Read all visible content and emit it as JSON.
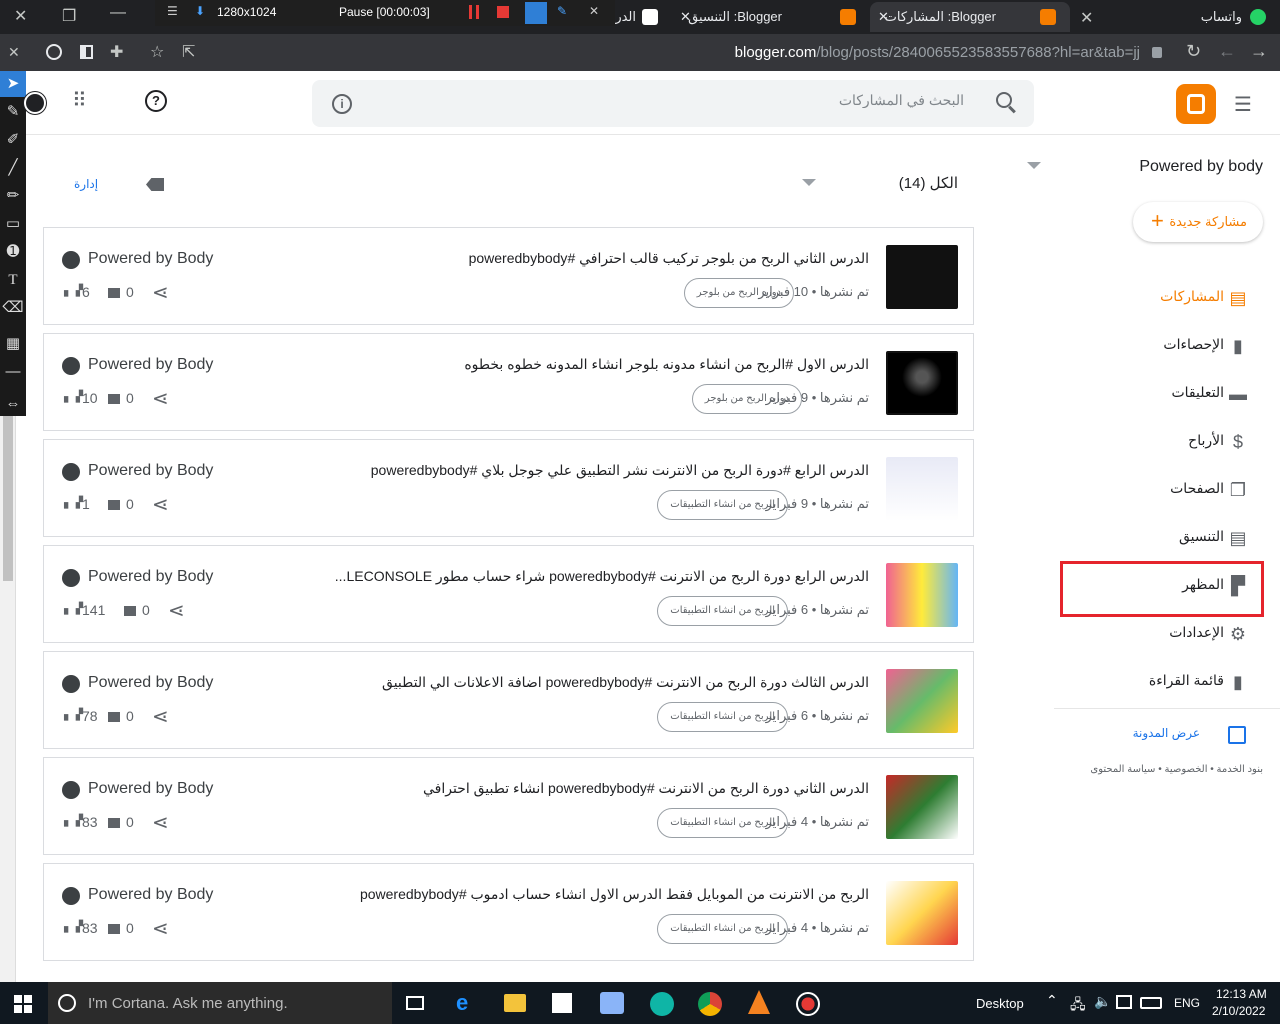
{
  "browser": {
    "tabs": [
      {
        "label": "واتساب"
      },
      {
        "label": "Blogger: المشاركات"
      },
      {
        "label": "Blogger: التنسيق"
      },
      {
        "label": "الدر"
      }
    ],
    "url_domain": "blogger.com",
    "url_path": "/blog/posts/2840065523583557688?hl=ar&tab=jj"
  },
  "recorder": {
    "size": "1280x1024",
    "status": "Pause [00:00:03]"
  },
  "search": {
    "placeholder": "البحث في المشاركات"
  },
  "filters": {
    "all": "الكل (14)",
    "manage": "إدارة"
  },
  "sidebar": {
    "blog_name": "Powered by body",
    "new_post": "مشاركة جديدة",
    "items": [
      {
        "label": "المشاركات",
        "icon": "posts-icon"
      },
      {
        "label": "الإحصاءات",
        "icon": "stats-icon"
      },
      {
        "label": "التعليقات",
        "icon": "comments-icon"
      },
      {
        "label": "الأرباح",
        "icon": "dollar-icon"
      },
      {
        "label": "الصفحات",
        "icon": "pages-icon"
      },
      {
        "label": "التنسيق",
        "icon": "layout-icon"
      },
      {
        "label": "المظهر",
        "icon": "paint-roller-icon"
      },
      {
        "label": "الإعدادات",
        "icon": "gear-icon"
      },
      {
        "label": "قائمة القراءة",
        "icon": "bookmark-icon"
      }
    ],
    "view_blog": "عرض المدونة",
    "footer": {
      "terms": "بنود الخدمة",
      "privacy": "الخصوصية",
      "content_policy": "سياسة المحتوى"
    }
  },
  "posts": [
    {
      "title": "الدرس الثاني الربح من بلوجر تركيب قالب احترافي #poweredbybody",
      "meta": "تم نشرها • 10 فبراير",
      "label": "دوره الربح من بلوجر",
      "author": "Powered by Body",
      "views": "6",
      "comments": "0"
    },
    {
      "title": "الدرس الاول #الربح من انشاء مدونه بلوجر انشاء المدونه خطوه بخطوه",
      "meta": "تم نشرها • 9 فبراير",
      "label": "دوره الربح من بلوجر",
      "author": "Powered by Body",
      "views": "10",
      "comments": "0"
    },
    {
      "title": "الدرس الرابع #دورة الربح من الانترنت نشر التطبيق علي جوجل بلاي #poweredbybody",
      "meta": "تم نشرها • 9 فبراير",
      "label": "الربح من انشاء التطبيقات",
      "author": "Powered by Body",
      "views": "1",
      "comments": "0"
    },
    {
      "title": "الدرس الرابع دورة الربح من الانترنت #poweredbybody شراء حساب مطور LECONSOLE...",
      "meta": "تم نشرها • 6 فبراير",
      "label": "الربح من انشاء التطبيقات",
      "author": "Powered by Body",
      "views": "141",
      "comments": "0"
    },
    {
      "title": "الدرس الثالث دورة الربح من الانترنت #poweredbybody اضافة الاعلانات الي التطبيق",
      "meta": "تم نشرها • 6 فبراير",
      "label": "الربح من انشاء التطبيقات",
      "author": "Powered by Body",
      "views": "78",
      "comments": "0"
    },
    {
      "title": "الدرس الثاني دورة الربح من الانترنت #poweredbybody انشاء تطبيق احترافي",
      "meta": "تم نشرها • 4 فبراير",
      "label": "الربح من انشاء التطبيقات",
      "author": "Powered by Body",
      "views": "83",
      "comments": "0"
    },
    {
      "title": "الربح من الانترنت من الموبايل فقط الدرس الاول انشاء حساب ادموب #poweredbybody",
      "meta": "تم نشرها • 4 فبراير",
      "label": "الربح من انشاء التطبيقات",
      "author": "Powered by Body",
      "views": "83",
      "comments": "0"
    }
  ],
  "taskbar": {
    "cortana": "I'm Cortana. Ask me anything.",
    "desktop": "Desktop",
    "lang": "ENG",
    "time": "12:13 AM",
    "date": "2/10/2022"
  },
  "colors": {
    "brand": "#f57d00",
    "highlight": "#e5242c",
    "link": "#1a73e8"
  }
}
